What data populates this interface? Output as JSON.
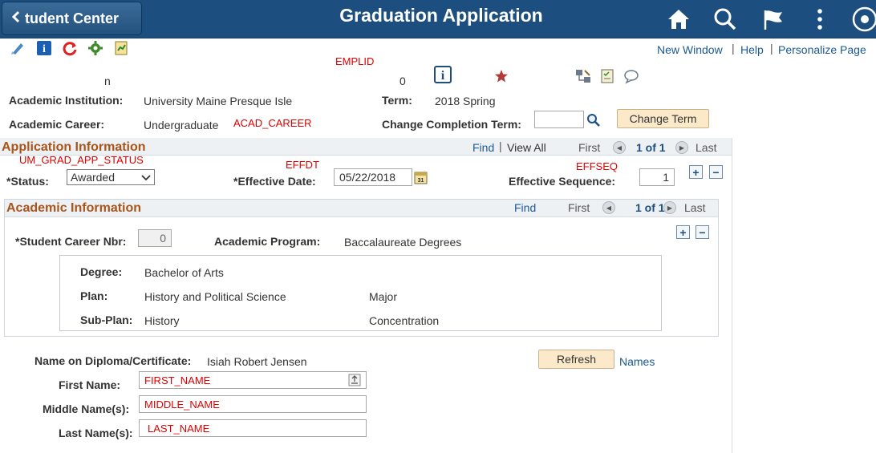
{
  "header": {
    "back_label": "tudent Center",
    "title": "Graduation Application"
  },
  "toolbar": {
    "new_window": "New Window",
    "help": "Help",
    "personalize": "Personalize Page"
  },
  "student": {
    "name_fragment": "n",
    "emplid_label": "EMPLID",
    "emplid_fragment": "0"
  },
  "institution": {
    "institution_label": "Academic Institution:",
    "institution_value": "University Maine Presque Isle",
    "term_label": "Term:",
    "term_value": "2018 Spring",
    "career_label": "Academic Career:",
    "career_value": "Undergraduate",
    "career_field": "ACAD_CAREER",
    "completion_label": "Change Completion Term:",
    "completion_value": "",
    "change_term_button": "Change Term"
  },
  "application": {
    "title": "Application Information",
    "find": "Find",
    "view_all": "View All",
    "first": "First",
    "count": "1 of 1",
    "last": "Last",
    "status_field": "UM_GRAD_APP_STATUS",
    "status_label": "*Status:",
    "status_value": "Awarded",
    "effdt_field": "EFFDT",
    "effdt_label": "*Effective Date:",
    "effdt_value": "05/22/2018",
    "effseq_field": "EFFSEQ",
    "effseq_label": "Effective Sequence:",
    "effseq_value": "1"
  },
  "academic": {
    "title": "Academic Information",
    "find": "Find",
    "first": "First",
    "count": "1 of 1",
    "last": "Last",
    "career_nbr_label": "*Student Career Nbr:",
    "career_nbr_value": "0",
    "program_label": "Academic Program:",
    "program_value": "Baccalaureate Degrees",
    "degree_label": "Degree:",
    "degree_value": "Bachelor of Arts",
    "plan_label": "Plan:",
    "plan_value": "History and Political Science",
    "plan_type": "Major",
    "subplan_label": "Sub-Plan:",
    "subplan_value": "History",
    "subplan_type": "Concentration"
  },
  "diploma": {
    "name_label": "Name on Diploma/Certificate:",
    "name_value": "Isiah Robert Jensen",
    "refresh_button": "Refresh",
    "names_link": "Names",
    "first_label": "First Name:",
    "first_field": "FIRST_NAME",
    "middle_label": "Middle Name(s):",
    "middle_field": "MIDDLE_NAME",
    "last_label": "Last Name(s):",
    "last_field": "LAST_NAME"
  },
  "colors": {
    "header_bg": "#1c4f7f",
    "section_title": "#a9541a",
    "field_name_red": "#e00000",
    "link": "#1a5a96",
    "button_bg": "#fbe9c9"
  }
}
